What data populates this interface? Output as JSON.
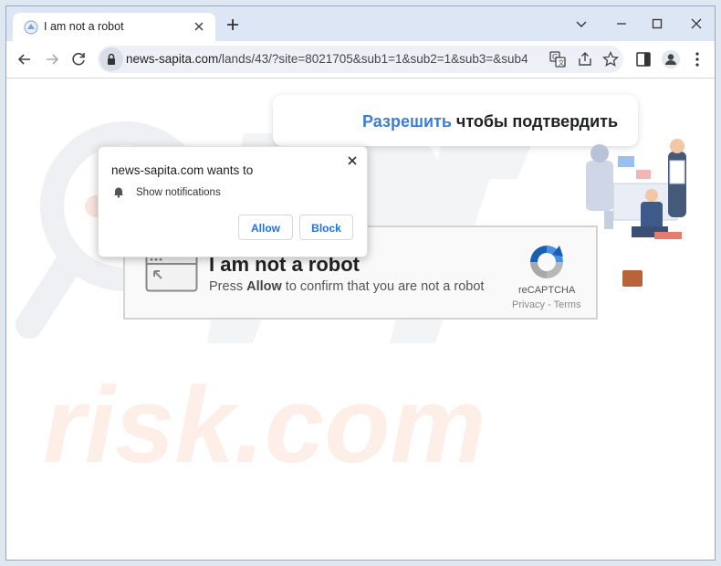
{
  "tab": {
    "title": "I am not a robot"
  },
  "address_bar": {
    "host": "news-sapita.com",
    "path": "/lands/43/?site=8021705&sub1=1&sub2=1&sub3=&sub4="
  },
  "banner": {
    "highlight": "Разрешить",
    "rest": " чтобы подтвердить"
  },
  "captcha": {
    "title": "I am not a robot",
    "sub_prefix": "Press ",
    "sub_bold": "Allow",
    "sub_suffix": " to confirm that you are not a robot",
    "recaptcha_label": "reCAPTCHA",
    "links": "Privacy - Terms"
  },
  "popup": {
    "title": "news-sapita.com wants to",
    "permission": "Show notifications",
    "allow": "Allow",
    "block": "Block"
  },
  "watermark": {
    "text": "risk.com"
  },
  "colors": {
    "accent": "#1a73e8",
    "banner_highlight": "#3b7ed6",
    "titlebar": "#dde6f4",
    "omnibox": "#edf1f7"
  },
  "icons": [
    "favicon-icon",
    "close-icon",
    "plus-icon",
    "minimize-icon",
    "maximize-icon",
    "window-close-icon",
    "back-icon",
    "forward-icon",
    "reload-icon",
    "lock-icon",
    "translate-icon",
    "share-icon",
    "star-icon",
    "sidepanel-icon",
    "profile-icon",
    "kebab-menu-icon",
    "bell-icon",
    "recaptcha-icon",
    "browser-window-icon"
  ]
}
